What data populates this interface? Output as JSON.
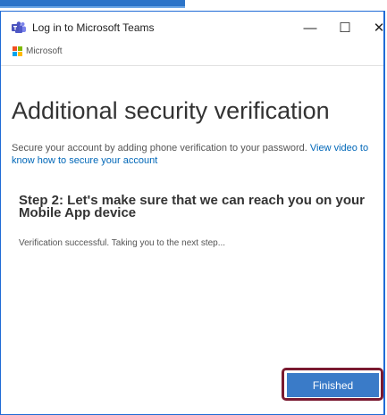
{
  "window": {
    "title": "Log in to Microsoft Teams",
    "minimize_glyph": "—",
    "maximize_glyph": "☐",
    "close_glyph": "✕"
  },
  "brand": {
    "name": "Microsoft",
    "colors": [
      "#f25022",
      "#7fba00",
      "#00a4ef",
      "#ffb900"
    ]
  },
  "page": {
    "heading": "Additional security verification",
    "description": "Secure your account by adding phone verification to your password.",
    "description_link": "View video to know how to secure your account",
    "step_title": "Step 2: Let's make sure that we can reach you on your Mobile App device",
    "status_text": "Verification successful. Taking you to the next step..."
  },
  "actions": {
    "finish_label": "Finished"
  },
  "colors": {
    "accent": "#3a7bc8",
    "link": "#0067b8",
    "highlight": "#7a1a30",
    "teams": "#5059c9"
  }
}
